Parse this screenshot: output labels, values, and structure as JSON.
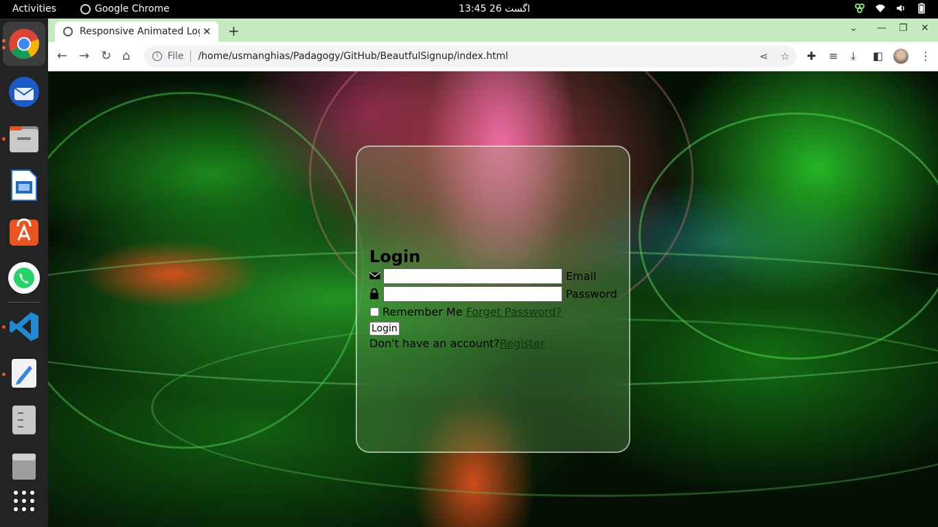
{
  "topbar": {
    "activities": "Activities",
    "app_name": "Google Chrome",
    "clock": "13:45  26 اگست",
    "tray_icons": [
      "network-icon",
      "wifi-icon",
      "volume-icon",
      "battery-icon"
    ]
  },
  "dock": {
    "apps": [
      "google-chrome",
      "thunderbird",
      "files",
      "libreoffice-impress",
      "app-center",
      "whatsapp",
      "vscode",
      "text-editor",
      "file-roller",
      "ssd-drive",
      "show-apps"
    ]
  },
  "browser": {
    "tab_title": "Responsive Animated Login Form",
    "scheme_label": "File",
    "url": "/home/usmanghias/Padagogy/GitHub/BeautfulSignup/index.html"
  },
  "page": {
    "title": "Login",
    "email_label": "Email",
    "password_label": "Password",
    "remember_label": "Remember Me",
    "forgot_label": "Forget Password?",
    "login_button": "Login",
    "no_account_text": "Don't have an account?",
    "register_label": "Register",
    "email_value": "",
    "password_value": "",
    "remember_checked": false
  },
  "colors": {
    "tabstrip": "#c5eac0",
    "link": "#0b3a0b"
  }
}
